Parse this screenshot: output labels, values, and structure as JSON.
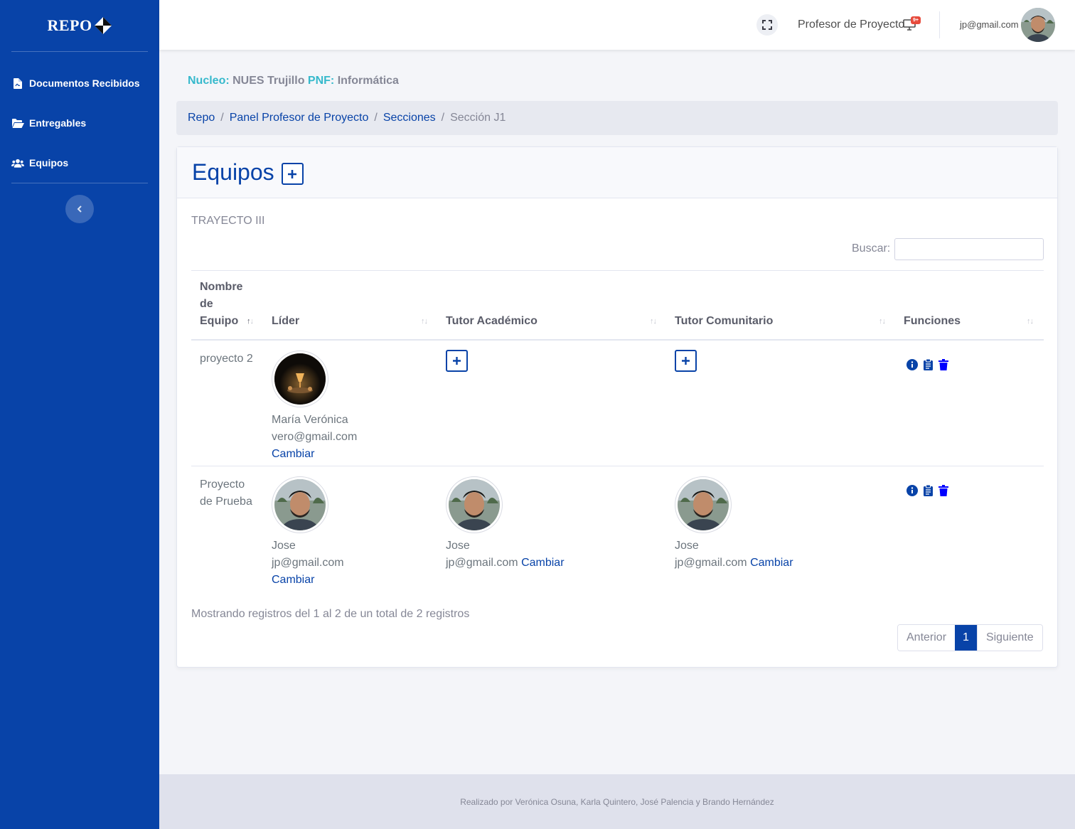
{
  "brand": {
    "name": "REPO"
  },
  "sidebar": {
    "items": [
      {
        "label": "Documentos Recibidos",
        "icon": "file-pdf-icon"
      },
      {
        "label": "Entregables",
        "icon": "folder-open-icon"
      },
      {
        "label": "Equipos",
        "icon": "users-icon"
      }
    ]
  },
  "topbar": {
    "role": "Profesor de Proyecto",
    "badge": "9+",
    "email": "jp@gmail.com"
  },
  "info": {
    "nucleo_key": "Nucleo:",
    "nucleo_val": "NUES Trujillo",
    "pnf_key": "PNF:",
    "pnf_val": "Informática"
  },
  "breadcrumb": [
    "Repo",
    "Panel Profesor de Proyecto",
    "Secciones",
    "Sección J1"
  ],
  "card": {
    "title": "Equipos",
    "subtitle": "TRAYECTO III",
    "search_label": "Buscar:",
    "search_value": ""
  },
  "table": {
    "headers": {
      "name_l1": "Nombre",
      "name_l2": "de",
      "name_l3": "Equipo",
      "leader": "Líder",
      "tutor_acad": "Tutor Académico",
      "tutor_com": "Tutor Comunitario",
      "funcs": "Funciones"
    },
    "rows": [
      {
        "name": "proyecto 2",
        "leader": {
          "name": "María Verónica",
          "email": "vero@gmail.com",
          "change": "Cambiar"
        }
      },
      {
        "name_l1": "Proyecto",
        "name_l2": "de Prueba",
        "leader": {
          "name": "Jose",
          "email": "jp@gmail.com",
          "change": "Cambiar"
        },
        "tutor_acad": {
          "name": "Jose",
          "email": "jp@gmail.com",
          "change": "Cambiar"
        },
        "tutor_com": {
          "name": "Jose",
          "email": "jp@gmail.com",
          "change": "Cambiar"
        }
      }
    ]
  },
  "pagination": {
    "info": "Mostrando registros del 1 al 2 de un total de 2 registros",
    "prev": "Anterior",
    "page": "1",
    "next": "Siguiente"
  },
  "footer": {
    "text": "Realizado por Verónica Osuna, Karla Quintero, José Palencia y Brando Hernández"
  },
  "colors": {
    "primary": "#0843a8",
    "info": "#36b9cc",
    "danger": "#e74a3b"
  }
}
